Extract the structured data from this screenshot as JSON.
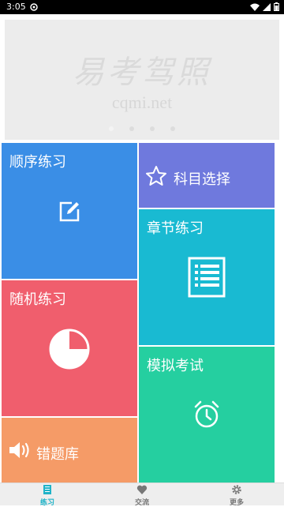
{
  "status_bar": {
    "time": "3:05"
  },
  "banner": {
    "logo_text": "易考驾照",
    "url_text": "cqmi.net",
    "page_count": 4,
    "active_index": 0
  },
  "tiles": {
    "sequential": {
      "label": "顺序练习",
      "icon": "edit-icon",
      "color": "#3a8ee6"
    },
    "subject": {
      "label": "科目选择",
      "icon": "star-icon",
      "color": "#6f79dd"
    },
    "chapter": {
      "label": "章节练习",
      "icon": "document-icon",
      "color": "#19bad2"
    },
    "random": {
      "label": "随机练习",
      "icon": "pie-chart-icon",
      "color": "#f05e6d"
    },
    "mock_exam": {
      "label": "模拟考试",
      "icon": "alarm-clock-icon",
      "color": "#25cfa0"
    },
    "wrong_questions": {
      "label": "错题库",
      "icon": "speaker-icon",
      "color": "#f59b67"
    }
  },
  "tab_bar": {
    "active": "practice",
    "accent": "#1fb3c8",
    "tabs": [
      {
        "label": "练习",
        "icon": "book-icon"
      },
      {
        "label": "交流",
        "icon": "heart-icon"
      },
      {
        "label": "更多",
        "icon": "gear-icon"
      }
    ]
  }
}
